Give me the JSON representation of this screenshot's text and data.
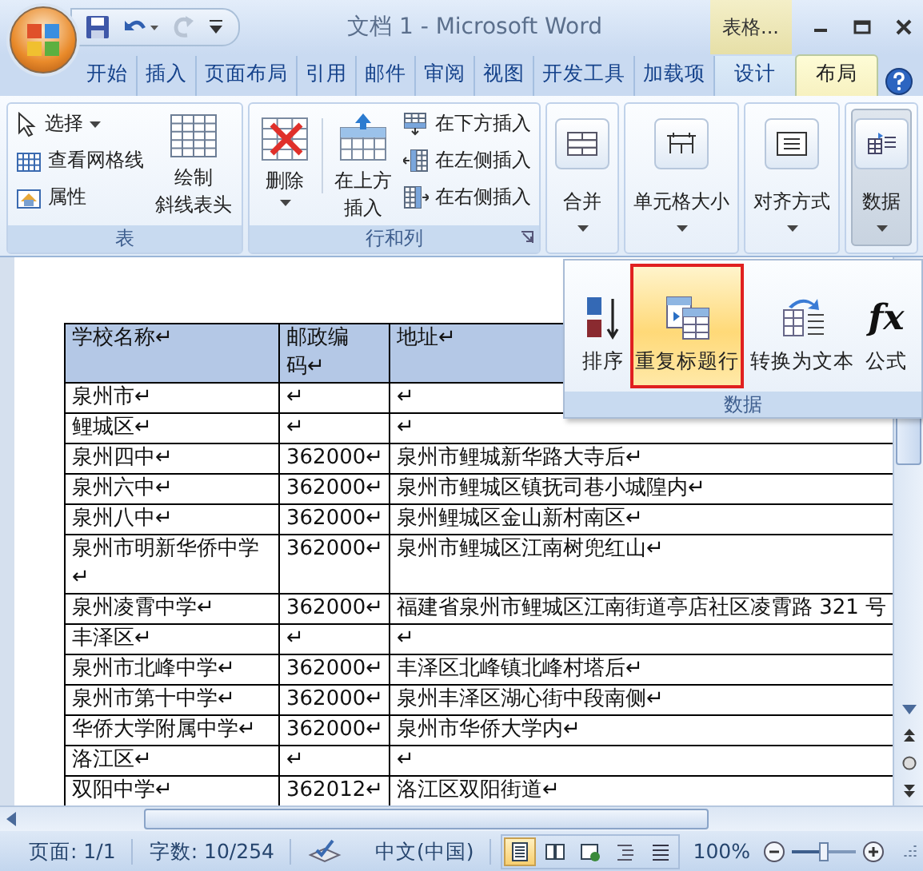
{
  "window": {
    "title": "文档 1 - Microsoft Word",
    "context_tab": "表格..."
  },
  "tabs": [
    {
      "label": "开始",
      "selected": false,
      "kind": "normal"
    },
    {
      "label": "插入",
      "selected": false,
      "kind": "normal"
    },
    {
      "label": "页面布局",
      "selected": false,
      "kind": "normal"
    },
    {
      "label": "引用",
      "selected": false,
      "kind": "normal"
    },
    {
      "label": "邮件",
      "selected": false,
      "kind": "normal"
    },
    {
      "label": "审阅",
      "selected": false,
      "kind": "normal"
    },
    {
      "label": "视图",
      "selected": false,
      "kind": "normal"
    },
    {
      "label": "开发工具",
      "selected": false,
      "kind": "normal"
    },
    {
      "label": "加载项",
      "selected": false,
      "kind": "normal"
    },
    {
      "label": "设计",
      "selected": false,
      "kind": "context"
    },
    {
      "label": "布局",
      "selected": true,
      "kind": "context"
    }
  ],
  "ribbon": {
    "groups": [
      {
        "label": "表",
        "items": [
          {
            "kind": "small",
            "label": "选择",
            "dropdown": true
          },
          {
            "kind": "small",
            "label": "查看网格线",
            "dropdown": false
          },
          {
            "kind": "small",
            "label": "属性",
            "dropdown": false
          },
          {
            "kind": "large",
            "lines": [
              "绘制",
              "斜线表头"
            ],
            "dropdown": false
          }
        ]
      },
      {
        "label": "行和列",
        "launcher": true,
        "items": [
          {
            "kind": "large",
            "lines": [
              "删除"
            ],
            "dropdown": true
          },
          {
            "kind": "large",
            "lines": [
              "在上方",
              "插入"
            ],
            "dropdown": false
          },
          {
            "kind": "small",
            "label": "在下方插入",
            "dropdown": false
          },
          {
            "kind": "small",
            "label": "在左侧插入",
            "dropdown": false
          },
          {
            "kind": "small",
            "label": "在右侧插入",
            "dropdown": false
          }
        ]
      },
      {
        "items": [
          {
            "kind": "collapsed",
            "label": "合并",
            "expanded": false
          }
        ]
      },
      {
        "items": [
          {
            "kind": "collapsed",
            "label": "单元格大小",
            "expanded": false
          }
        ]
      },
      {
        "items": [
          {
            "kind": "collapsed",
            "label": "对齐方式",
            "expanded": false
          }
        ]
      },
      {
        "items": [
          {
            "kind": "collapsed",
            "label": "数据",
            "expanded": true
          }
        ]
      }
    ]
  },
  "popup": {
    "label": "数据",
    "buttons": [
      {
        "label": "排序",
        "selected": false
      },
      {
        "label": "重复标题行",
        "selected": true
      },
      {
        "label": "转换为文本",
        "selected": false
      },
      {
        "label": "公式",
        "selected": false,
        "glyph": "fx"
      }
    ]
  },
  "document": {
    "table": {
      "rows": [
        {
          "selected": true,
          "cells": [
            "学校名称↵",
            "邮政编码↵",
            "地址↵"
          ]
        },
        {
          "selected": false,
          "cells": [
            "泉州市↵",
            "↵",
            "↵"
          ]
        },
        {
          "selected": false,
          "cells": [
            "鲤城区↵",
            "↵",
            "↵"
          ]
        },
        {
          "selected": false,
          "cells": [
            "泉州四中↵",
            "362000↵",
            "泉州市鲤城新华路大寺后↵"
          ]
        },
        {
          "selected": false,
          "cells": [
            "泉州六中↵",
            "362000↵",
            "泉州市鲤城区镇抚司巷小城隍内↵"
          ]
        },
        {
          "selected": false,
          "cells": [
            "泉州八中↵",
            "362000↵",
            "泉州鲤城区金山新村南区↵"
          ]
        },
        {
          "selected": false,
          "cells": [
            "泉州市明新华侨中学↵",
            "362000↵",
            "泉州市鲤城区江南树兜红山↵"
          ]
        },
        {
          "selected": false,
          "cells": [
            "泉州凌霄中学↵",
            "362000↵",
            "福建省泉州市鲤城区江南街道亭店社区凌霄路 321 号"
          ]
        },
        {
          "selected": false,
          "cells": [
            "丰泽区↵",
            "↵",
            "↵"
          ]
        },
        {
          "selected": false,
          "cells": [
            "泉州市北峰中学↵",
            "362000↵",
            "丰泽区北峰镇北峰村塔后↵"
          ]
        },
        {
          "selected": false,
          "cells": [
            "泉州市第十中学↵",
            "362000↵",
            "泉州丰泽区湖心街中段南侧↵"
          ]
        },
        {
          "selected": false,
          "cells": [
            "华侨大学附属中学↵",
            "362000↵",
            "泉州市华侨大学内↵"
          ]
        },
        {
          "selected": false,
          "cells": [
            "洛江区↵",
            "↵",
            "↵"
          ]
        },
        {
          "selected": false,
          "cells": [
            "双阳中学↵",
            "362012↵",
            "洛江区双阳街道↵"
          ]
        }
      ]
    }
  },
  "status_bar": {
    "page": "页面: 1/1",
    "words": "字数: 10/254",
    "language": "中文(中国)",
    "views": [
      {
        "selected": true
      },
      {
        "selected": false
      },
      {
        "selected": false
      },
      {
        "selected": false
      },
      {
        "selected": false
      }
    ],
    "zoom": {
      "reading": "100%",
      "level": 0.5
    }
  }
}
